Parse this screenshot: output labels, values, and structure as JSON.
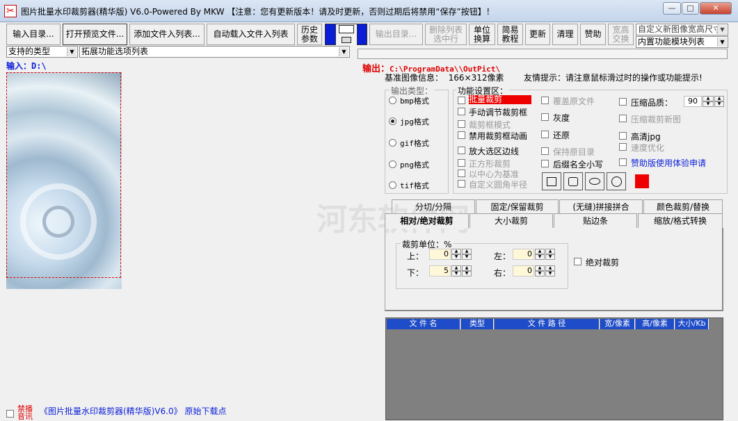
{
  "window": {
    "title": "图片批量水印裁剪器(精华版) V6.0-Powered By MKW 【注意：您有更新版本！请及时更新，否则过期后将禁用“保存”按钮】！",
    "min": "—",
    "max": "□",
    "close": "✕"
  },
  "toolbar": {
    "input_dir": "输入目录...",
    "open_preview": "打开预览文件...",
    "add_files": "添加文件入列表...",
    "auto_load": "自动载入文件入列表",
    "history_1": "历史",
    "history_2": "参数",
    "output_dir": "输出目录...",
    "delete_row_1": "删除列表",
    "delete_row_2": "选中行",
    "unit_1": "单位",
    "unit_2": "换算",
    "tutorial_1": "简易",
    "tutorial_2": "教程",
    "update": "更新",
    "clean": "清理",
    "donate": "赞助",
    "swap_1": "宽高",
    "swap_2": "交换",
    "custom_size": "自定义新图像宽高尺寸",
    "builtin_modules": "内置功能模块列表"
  },
  "filters": {
    "type": "支持的类型",
    "ext": "拓展功能选项列表"
  },
  "input": {
    "label": "输入：",
    "path": "D:\\"
  },
  "output": {
    "label": "输出：",
    "path": "C:\\ProgramData\\\\OutPict\\"
  },
  "info": {
    "base_label": "基准图像信息：",
    "base_value": "166×312像素",
    "tip_label": "友情提示：",
    "tip_value": "请注意鼠标滑过时的操作或功能提示!"
  },
  "output_type": {
    "title": "输出类型：",
    "options": [
      "bmp格式",
      "jpg格式",
      "gif格式",
      "png格式",
      "tif格式"
    ],
    "selected": "jpg格式"
  },
  "features": {
    "title": "功能设置区：",
    "col1": [
      {
        "label": "批量裁剪",
        "enabled": true
      },
      {
        "label": "手动调节裁剪框",
        "enabled": true
      },
      {
        "label": "裁剪框模式",
        "enabled": false
      },
      {
        "label": "禁用裁剪框动画",
        "enabled": true
      },
      {
        "label": "放大选区边线",
        "enabled": true
      },
      {
        "label": "正方形裁剪",
        "enabled": false
      },
      {
        "label": "以中心为基准",
        "enabled": false
      },
      {
        "label": "自定义圆角半径",
        "enabled": false
      }
    ],
    "col2": [
      {
        "label": "覆盖原文件",
        "enabled": false
      },
      {
        "label": "灰度",
        "enabled": true
      },
      {
        "label": "还原",
        "enabled": true
      },
      {
        "label": "保持原目录",
        "enabled": false
      },
      {
        "label": "后缀名全小写",
        "enabled": true
      }
    ],
    "col3": [
      {
        "label": "压缩品质：",
        "enabled": true
      },
      {
        "label": "压缩裁剪新图",
        "enabled": false
      },
      {
        "label": "高清jpg",
        "enabled": true
      },
      {
        "label": "速度优化",
        "enabled": false
      },
      {
        "label": "赞助版使用体验申请",
        "enabled": true
      }
    ],
    "quality": "90",
    "accent_color": "#ee0000"
  },
  "tabs_row1": [
    "分切/分隔",
    "固定/保留裁剪",
    "(无缝)拼接拼合",
    "颜色裁剪/替换"
  ],
  "tabs_row2": [
    "相对/绝对裁剪",
    "大小裁剪",
    "贴边条",
    "缩放/格式转换"
  ],
  "crop": {
    "unit_label": "裁剪单位：%",
    "top_label": "上：",
    "top": "0",
    "left_label": "左：",
    "left": "0",
    "bottom_label": "下：",
    "bottom": "5",
    "right_label": "右：",
    "right": "0",
    "absolute": "绝对裁剪"
  },
  "table": {
    "headers": [
      "文 件 名",
      "类型",
      "文 件 路 径",
      "宽/像素",
      "高/像素",
      "大小/Kb"
    ]
  },
  "footer": {
    "badge_1": "禁播",
    "badge_2": "音讯",
    "text": "《图片批量水印裁剪器(精华版)V6.0》 原始下载点"
  },
  "watermark": "河东软件网"
}
